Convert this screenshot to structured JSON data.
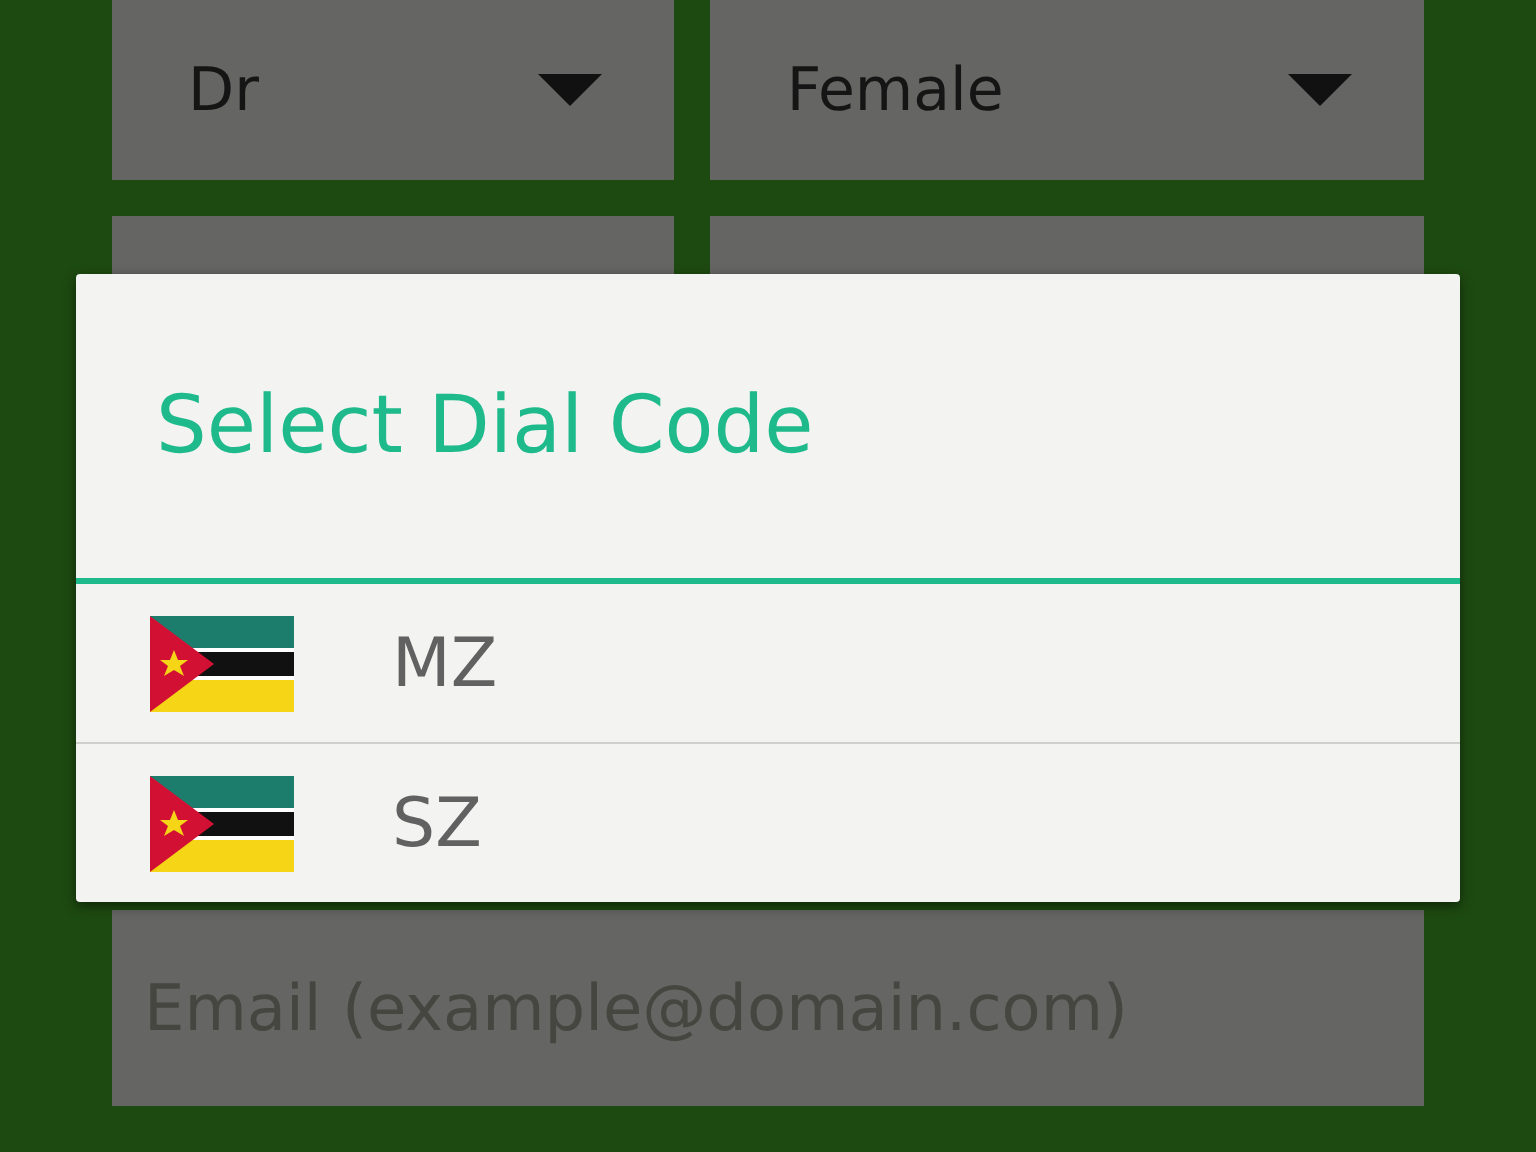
{
  "form": {
    "rows": [
      [
        {
          "kind": "dropdown",
          "value": "Dr"
        },
        {
          "kind": "dropdown",
          "value": "Female"
        }
      ],
      [
        {
          "kind": "input"
        },
        {
          "kind": "input"
        }
      ],
      [
        {
          "kind": "input",
          "placeholder": "Email (example@domain.com)"
        }
      ]
    ]
  },
  "dialog": {
    "title": "Select Dial Code",
    "items": [
      {
        "label": "MZ"
      },
      {
        "label": "SZ"
      }
    ]
  }
}
